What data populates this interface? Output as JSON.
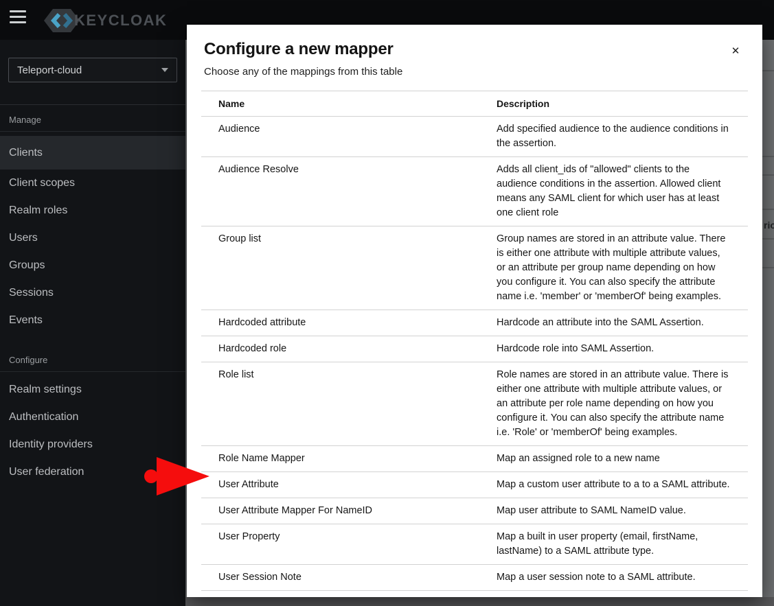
{
  "topbar": {
    "brand": "KEYCLOAK"
  },
  "sidebar": {
    "realm_selector": {
      "value": "Teleport-cloud"
    },
    "sections": [
      {
        "label": "Manage",
        "items": [
          {
            "label": "Clients",
            "selected": true
          },
          {
            "label": "Client scopes",
            "selected": false
          },
          {
            "label": "Realm roles",
            "selected": false
          },
          {
            "label": "Users",
            "selected": false
          },
          {
            "label": "Groups",
            "selected": false
          },
          {
            "label": "Sessions",
            "selected": false
          },
          {
            "label": "Events",
            "selected": false
          }
        ]
      },
      {
        "label": "Configure",
        "items": [
          {
            "label": "Realm settings",
            "selected": false
          },
          {
            "label": "Authentication",
            "selected": false
          },
          {
            "label": "Identity providers",
            "selected": false
          },
          {
            "label": "User federation",
            "selected": false
          }
        ]
      }
    ]
  },
  "modal": {
    "title": "Configure a new mapper",
    "subtitle": "Choose any of the mappings from this table",
    "close_label": "✕",
    "table": {
      "columns": [
        "Name",
        "Description"
      ],
      "rows": [
        {
          "name": "Audience",
          "description": "Add specified audience to the audience conditions in the assertion."
        },
        {
          "name": "Audience Resolve",
          "description": "Adds all client_ids of \"allowed\" clients to the audience conditions in the assertion. Allowed client means any SAML client for which user has at least one client role"
        },
        {
          "name": "Group list",
          "description": "Group names are stored in an attribute value. There is either one attribute with multiple attribute values, or an attribute per group name depending on how you configure it. You can also specify the attribute name i.e. 'member' or 'memberOf' being examples."
        },
        {
          "name": "Hardcoded attribute",
          "description": "Hardcode an attribute into the SAML Assertion."
        },
        {
          "name": "Hardcoded role",
          "description": "Hardcode role into SAML Assertion."
        },
        {
          "name": "Role list",
          "description": "Role names are stored in an attribute value. There is either one attribute with multiple attribute values, or an attribute per role name depending on how you configure it. You can also specify the attribute name i.e. 'Role' or 'memberOf' being examples."
        },
        {
          "name": "Role Name Mapper",
          "description": "Map an assigned role to a new name"
        },
        {
          "name": "User Attribute",
          "description": "Map a custom user attribute to a to a SAML attribute."
        },
        {
          "name": "User Attribute Mapper For NameID",
          "description": "Map user attribute to SAML NameID value."
        },
        {
          "name": "User Property",
          "description": "Map a built in user property (email, firstName, lastName) to a SAML attribute type."
        },
        {
          "name": "User Session Note",
          "description": "Map a user session note to a SAML attribute."
        }
      ]
    }
  },
  "background": {
    "partial_header": "rio"
  },
  "annotation": {
    "arrow_color": "#f50d0d"
  }
}
